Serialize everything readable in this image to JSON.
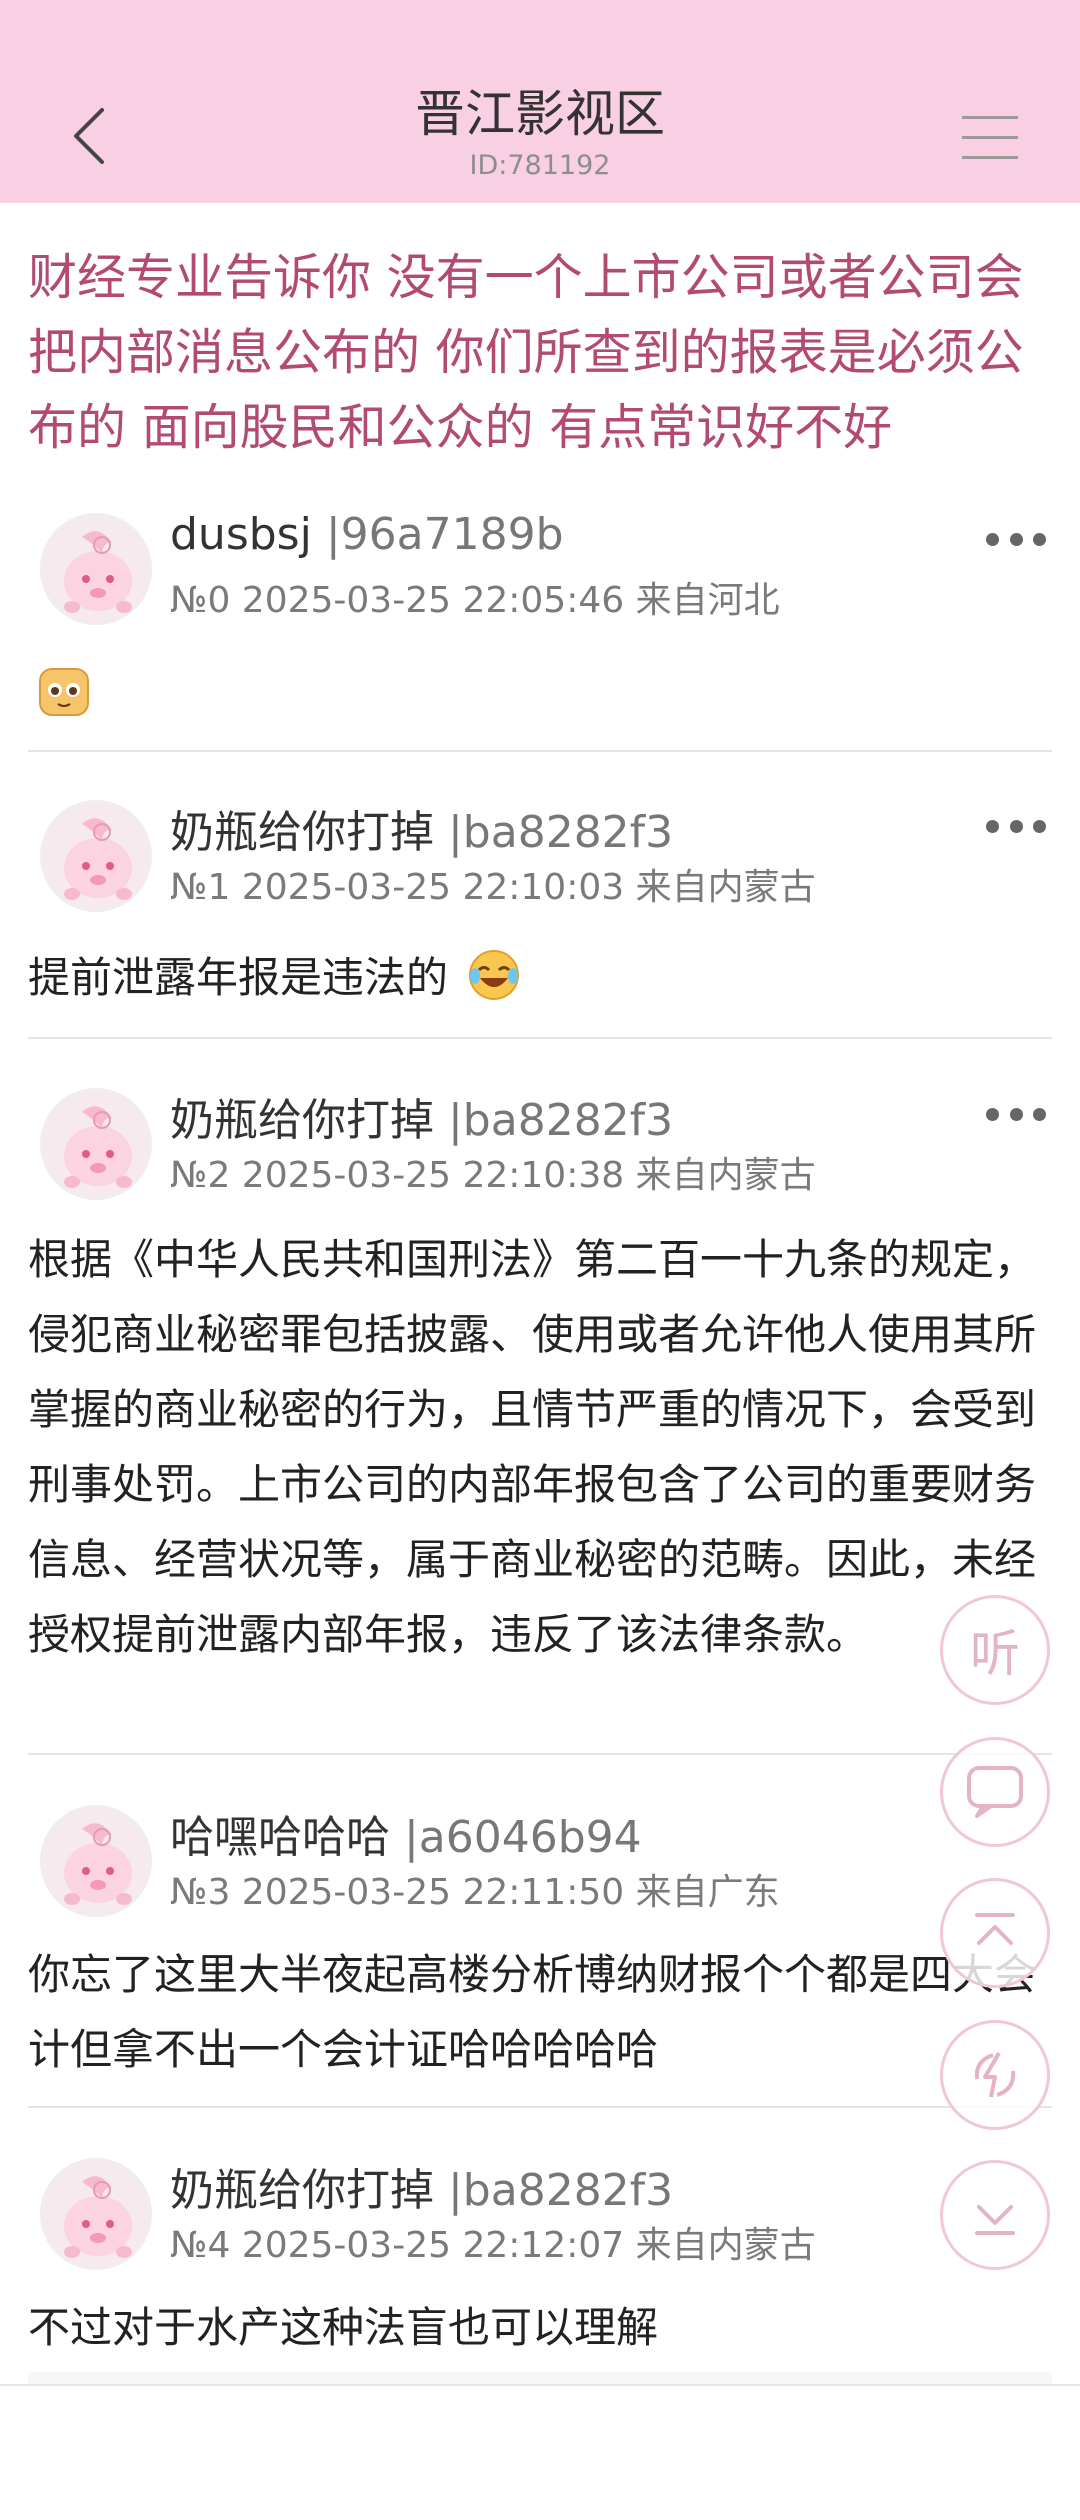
{
  "header": {
    "title": "晋江影视区",
    "id_text": "ID:781192",
    "bg_color": "#f9cfe3"
  },
  "thread": {
    "title": "财经专业告诉你  没有一个上市公司或者公司会把内部消息公布的 你们所查到的报表是必须公布的 面向股民和公众的 有点常识好不好",
    "title_color": "#b24a72"
  },
  "posts": [
    {
      "author": "dusbsj",
      "uid": " |96a7189b",
      "meta": "№0 2025-03-25 22:05:46 来自河北",
      "content": ""
    },
    {
      "author": "奶瓶给你打掉",
      "uid": " |ba8282f3",
      "meta": "№1 2025-03-25 22:10:03 来自内蒙古",
      "content": "提前泄露年报是违法的"
    },
    {
      "author": "奶瓶给你打掉",
      "uid": " |ba8282f3",
      "meta": "№2 2025-03-25 22:10:38 来自内蒙古",
      "content": "根据《中华人民共和国刑法》第二百一十九条的规定，侵犯商业秘密罪包括披露、使用或者允许他人使用其所掌握的商业秘密的行为，且情节严重的情况下，会受到刑事处罚。上市公司的内部年报包含了公司的重要财务信息、经营状况等，属于商业秘密的范畴。因此，未经授权提前泄露内部年报，违反了该法律条款。"
    },
    {
      "author": "哈嘿哈哈哈",
      "uid": " |a6046b94",
      "meta": "№3 2025-03-25 22:11:50 来自广东",
      "content": "你忘了这里大半夜起高楼分析博纳财报个个都是四大会计但拿不出一个会计证哈哈哈哈哈"
    },
    {
      "author": "奶瓶给你打掉",
      "uid": " |ba8282f3",
      "meta": "№4 2025-03-25 22:12:07 来自内蒙古",
      "content": "不过对于水产这种法盲也可以理解"
    }
  ],
  "float_buttons": {
    "listen_label": "听",
    "icons": [
      "comment-icon",
      "scroll-top-icon",
      "refresh-icon",
      "scroll-bottom-icon"
    ]
  }
}
